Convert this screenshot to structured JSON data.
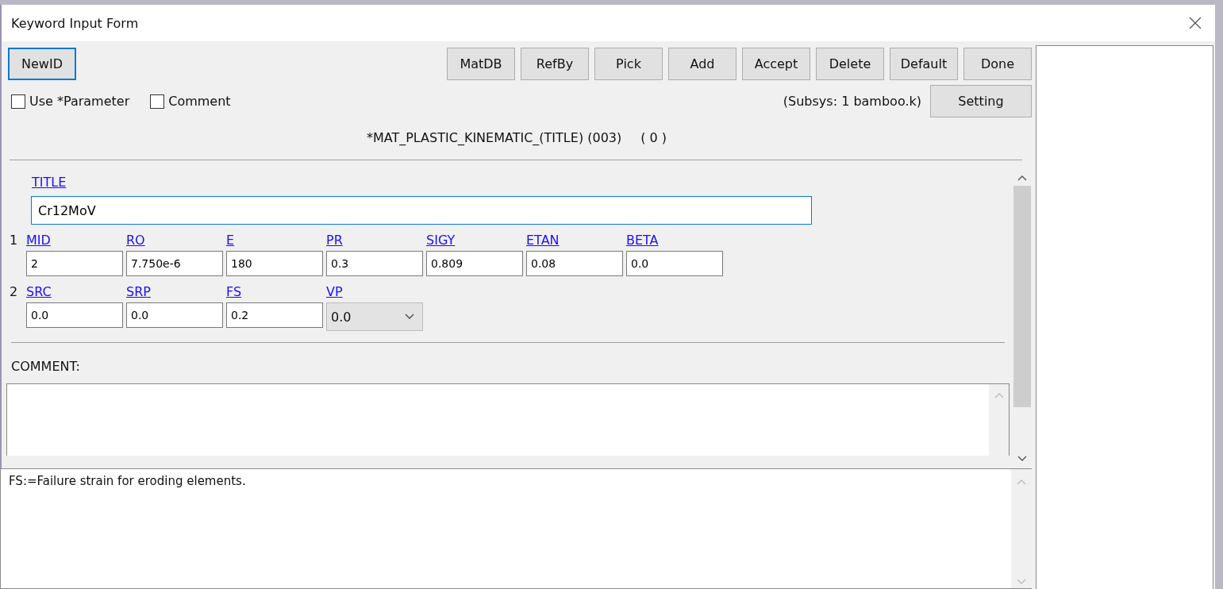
{
  "window": {
    "title": "Keyword Input Form"
  },
  "toolbar": {
    "left_button": {
      "label": "NewID",
      "focused": true
    },
    "buttons": [
      {
        "label": "MatDB",
        "focused": false
      },
      {
        "label": "RefBy",
        "focused": false
      },
      {
        "label": "Pick",
        "focused": false
      },
      {
        "label": "Add",
        "focused": false
      },
      {
        "label": "Accept",
        "focused": false
      },
      {
        "label": "Delete",
        "focused": false
      },
      {
        "label": "Default",
        "focused": false
      },
      {
        "label": "Done",
        "focused": false
      }
    ]
  },
  "options": {
    "checkboxes": [
      {
        "label": "Use *Parameter",
        "checked": false
      },
      {
        "label": "Comment",
        "checked": false
      }
    ],
    "subsys": "(Subsys: 1 bamboo.k)",
    "setting_button": "Setting"
  },
  "keyword": {
    "name": "*MAT_PLASTIC_KINEMATIC_(TITLE) (003)",
    "count": "( 0 )"
  },
  "title_field": {
    "label": "TITLE",
    "value": "Cr12MoV"
  },
  "cards": [
    {
      "number": "1",
      "fields": [
        {
          "label": "MID",
          "value": "2",
          "kind": "text"
        },
        {
          "label": "RO",
          "value": "7.750e-6",
          "kind": "text"
        },
        {
          "label": "E",
          "value": "180",
          "kind": "text"
        },
        {
          "label": "PR",
          "value": "0.3",
          "kind": "text"
        },
        {
          "label": "SIGY",
          "value": "0.809",
          "kind": "text"
        },
        {
          "label": "ETAN",
          "value": "0.08",
          "kind": "text"
        },
        {
          "label": "BETA",
          "value": "0.0",
          "kind": "text"
        }
      ]
    },
    {
      "number": "2",
      "fields": [
        {
          "label": "SRC",
          "value": "0.0",
          "kind": "text"
        },
        {
          "label": "SRP",
          "value": "0.0",
          "kind": "text"
        },
        {
          "label": "FS",
          "value": "0.2",
          "kind": "text"
        },
        {
          "label": "VP",
          "value": "0.0",
          "kind": "dropdown"
        }
      ]
    }
  ],
  "comment": {
    "label": "COMMENT:"
  },
  "help": {
    "text": "FS:=Failure strain for eroding elements."
  }
}
